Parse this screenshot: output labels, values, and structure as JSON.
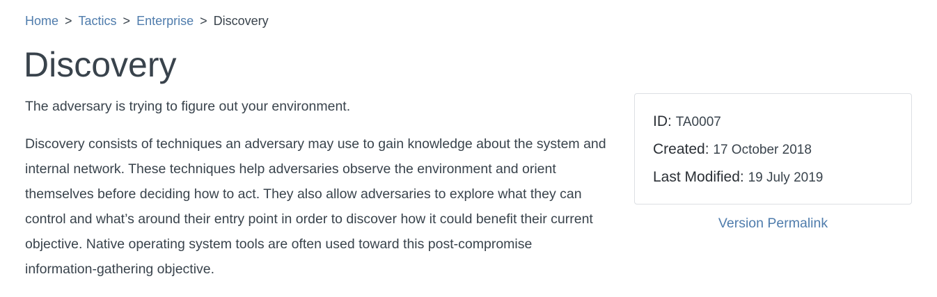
{
  "breadcrumb": {
    "items": [
      "Home",
      "Tactics",
      "Enterprise"
    ],
    "separator": ">",
    "current": "Discovery"
  },
  "page": {
    "title": "Discovery",
    "summary": "The adversary is trying to figure out your environment.",
    "description": "Discovery consists of techniques an adversary may use to gain knowledge about the system and internal network. These techniques help adversaries observe the environment and orient themselves before deciding how to act. They also allow adversaries to explore what they can control and what’s around their entry point in order to discover how it could benefit their current objective. Native operating system tools are often used toward this post-compromise information-gathering objective."
  },
  "card": {
    "id_label": "ID:",
    "id_value": "TA0007",
    "created_label": "Created:",
    "created_value": "17 October 2018",
    "modified_label": "Last Modified:",
    "modified_value": "19 July 2019"
  },
  "permalink": {
    "label": "Version Permalink"
  },
  "colors": {
    "link": "#4f7cac",
    "text": "#39434c",
    "border": "#dcdfe3"
  }
}
